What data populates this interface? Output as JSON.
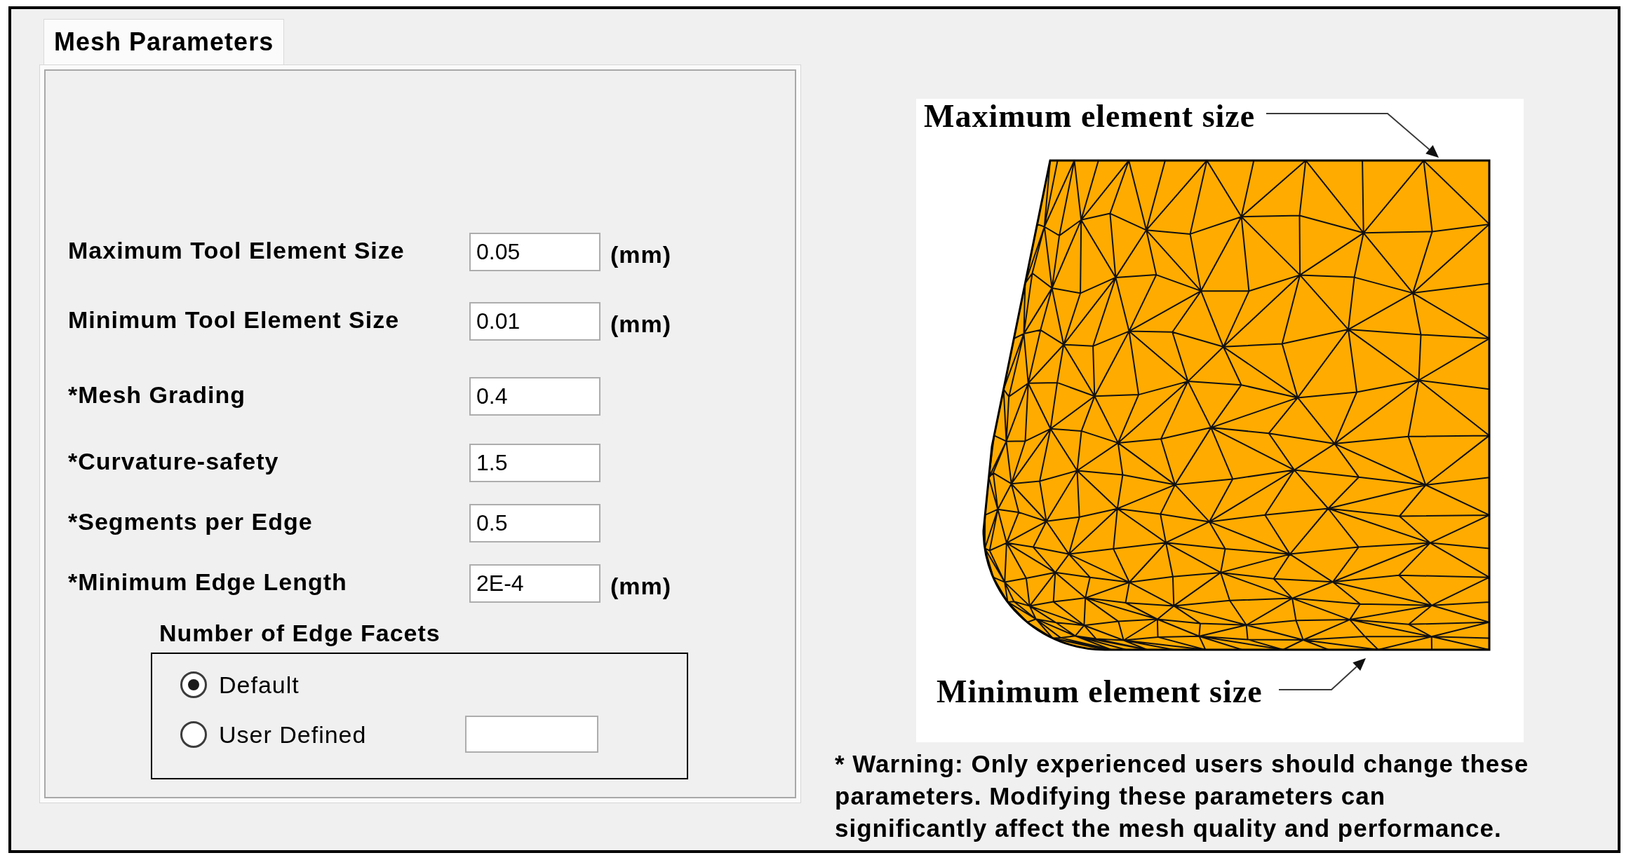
{
  "tabs": [
    {
      "label": "Mesh Parameters",
      "selected": true
    }
  ],
  "fields": [
    {
      "label": "Maximum Tool Element Size",
      "value": "0.05",
      "unit": "(mm)"
    },
    {
      "label": "Minimum Tool Element Size",
      "value": "0.01",
      "unit": "(mm)"
    },
    {
      "label": "*Mesh Grading",
      "value": "0.4"
    },
    {
      "label": "*Curvature-safety",
      "value": "1.5"
    },
    {
      "label": "*Segments per Edge",
      "value": "0.5"
    },
    {
      "label": "*Minimum Edge Length",
      "value": "2E-4",
      "unit": "(mm)"
    }
  ],
  "edge_facets": {
    "title": "Number of Edge Facets",
    "options": [
      {
        "label": "Default",
        "selected": true,
        "kind": "plain"
      },
      {
        "label": "User Defined",
        "selected": false,
        "kind": "with_field"
      }
    ]
  },
  "figure": {
    "top_label": "Maximum element size",
    "bottom_label": "Minimum element size"
  },
  "warning": "* Warning: Only experienced users should change these parameters. Modifying these parameters can significantly affect the mesh quality and performance."
}
